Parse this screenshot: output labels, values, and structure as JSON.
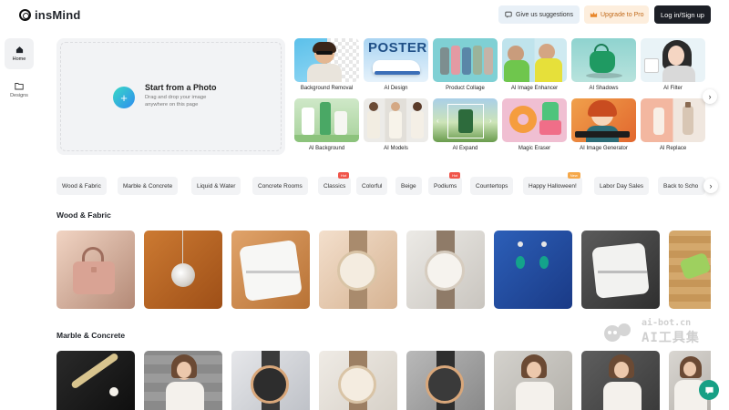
{
  "header": {
    "logo_text": "insMind",
    "suggest_label": "Give us suggestions",
    "pro_label": "Upgrade to Pro",
    "login_label": "Log in/Sign up"
  },
  "sidebar": {
    "items": [
      {
        "label": "Home",
        "icon": "home-icon",
        "active": true
      },
      {
        "label": "Designs",
        "icon": "folder-icon",
        "active": false
      }
    ]
  },
  "upload": {
    "title": "Start from a Photo",
    "subtitle": "Drag and drop your image anywhere on this page"
  },
  "tools": [
    {
      "label": "Background Removal"
    },
    {
      "label": "AI Design",
      "thumb_text": "POSTER"
    },
    {
      "label": "Product Collage"
    },
    {
      "label": "AI Image Enhancer"
    },
    {
      "label": "AI Shadows"
    },
    {
      "label": "AI Filter"
    },
    {
      "label": "AI Background"
    },
    {
      "label": "AI Models"
    },
    {
      "label": "AI Expand"
    },
    {
      "label": "Magic Eraser"
    },
    {
      "label": "AI Image Generator"
    },
    {
      "label": "AI Replace"
    }
  ],
  "chips": [
    {
      "label": "Wood & Fabric"
    },
    {
      "label": "Marble & Concrete"
    },
    {
      "label": "Liquid & Water"
    },
    {
      "label": "Concrete Rooms"
    },
    {
      "label": "Classics",
      "badge": "Hot"
    },
    {
      "label": "Colorful"
    },
    {
      "label": "Beige"
    },
    {
      "label": "Podiums",
      "badge": "Hot"
    },
    {
      "label": "Countertops"
    },
    {
      "label": "Happy Halloween!",
      "badge": "New"
    },
    {
      "label": "Labor Day Sales"
    },
    {
      "label": "Back to Scho"
    }
  ],
  "sections": [
    {
      "title": "Wood & Fabric"
    },
    {
      "title": "Marble & Concrete"
    }
  ],
  "watermark": {
    "line1": "ai-bot.cn",
    "line2": "AI工具集"
  },
  "colors": {
    "accent": "#2f8cf0",
    "hot_badge": "#f0554a",
    "new_badge": "#f5a84a",
    "chat": "#17a085"
  }
}
